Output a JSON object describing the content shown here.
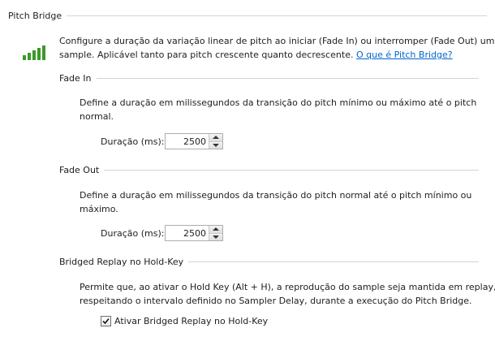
{
  "pitch_bridge": {
    "title": "Pitch Bridge",
    "icon": "signal-bars-icon",
    "description_line1": "Configure a duração da variação linear de pitch ao iniciar (Fade In) ou interromper (Fade Out) um",
    "description_line2": "sample. Aplicável tanto para pitch crescente quanto decrescente.",
    "help_link": "O que é Pitch Bridge?"
  },
  "fade_in": {
    "title": "Fade In",
    "description_line1": "Define a duração em milissegundos da transição do pitch mínimo ou máximo até o pitch",
    "description_line2": "normal.",
    "duration_label": "Duração (ms):",
    "duration_value": "2500"
  },
  "fade_out": {
    "title": "Fade Out",
    "description_line1": "Define a duração em milissegundos da transição do pitch normal até o pitch mínimo ou",
    "description_line2": "máximo.",
    "duration_label": "Duração (ms):",
    "duration_value": "2500"
  },
  "bridged_replay": {
    "title": "Bridged Replay no Hold-Key",
    "description_line1": "Permite que, ao ativar o Hold Key (Alt + H), a reprodução do sample seja mantida em replay,",
    "description_line2": "respeitando o intervalo definido no Sampler Delay, durante a execução do Pitch Bridge.",
    "checkbox_label": "Ativar Bridged Replay no Hold-Key",
    "checkbox_checked": true
  },
  "colors": {
    "icon_green": "#3a9a2a",
    "link": "#0066cc",
    "rule": "#d4d4d4"
  }
}
